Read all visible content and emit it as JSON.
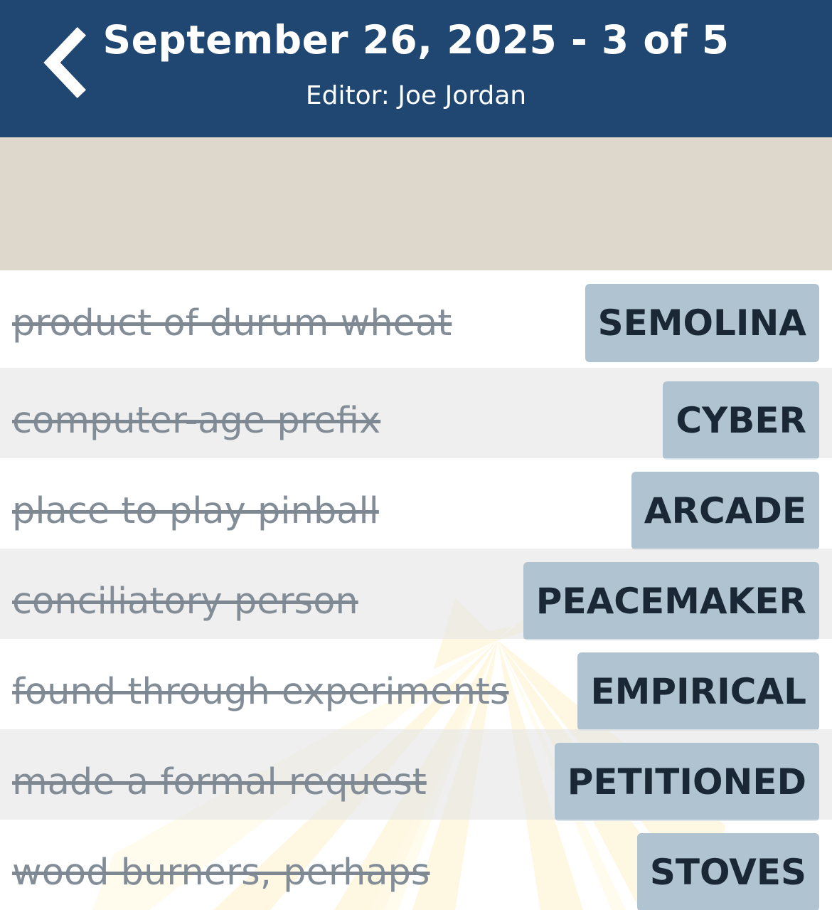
{
  "header": {
    "title": "September 26, 2025 - 3 of 5",
    "subtitle": "Editor: Joe Jordan",
    "back_icon": "chevron-left-icon"
  },
  "colors": {
    "header_bg": "#1f4771",
    "banner_bg": "#ded8cc",
    "answer_bg": "#b0c3d1",
    "clue_text": "#838d97"
  },
  "entries": [
    {
      "clue": "product of durum wheat",
      "answer": "SEMOLINA"
    },
    {
      "clue": "computer-age prefix",
      "answer": "CYBER"
    },
    {
      "clue": "place to play pinball",
      "answer": "ARCADE"
    },
    {
      "clue": "conciliatory person",
      "answer": "PEACEMAKER"
    },
    {
      "clue": "found through experiments",
      "answer": "EMPIRICAL"
    },
    {
      "clue": "made a formal request",
      "answer": "PETITIONED"
    },
    {
      "clue": "wood burners, perhaps",
      "answer": "STOVES"
    }
  ]
}
